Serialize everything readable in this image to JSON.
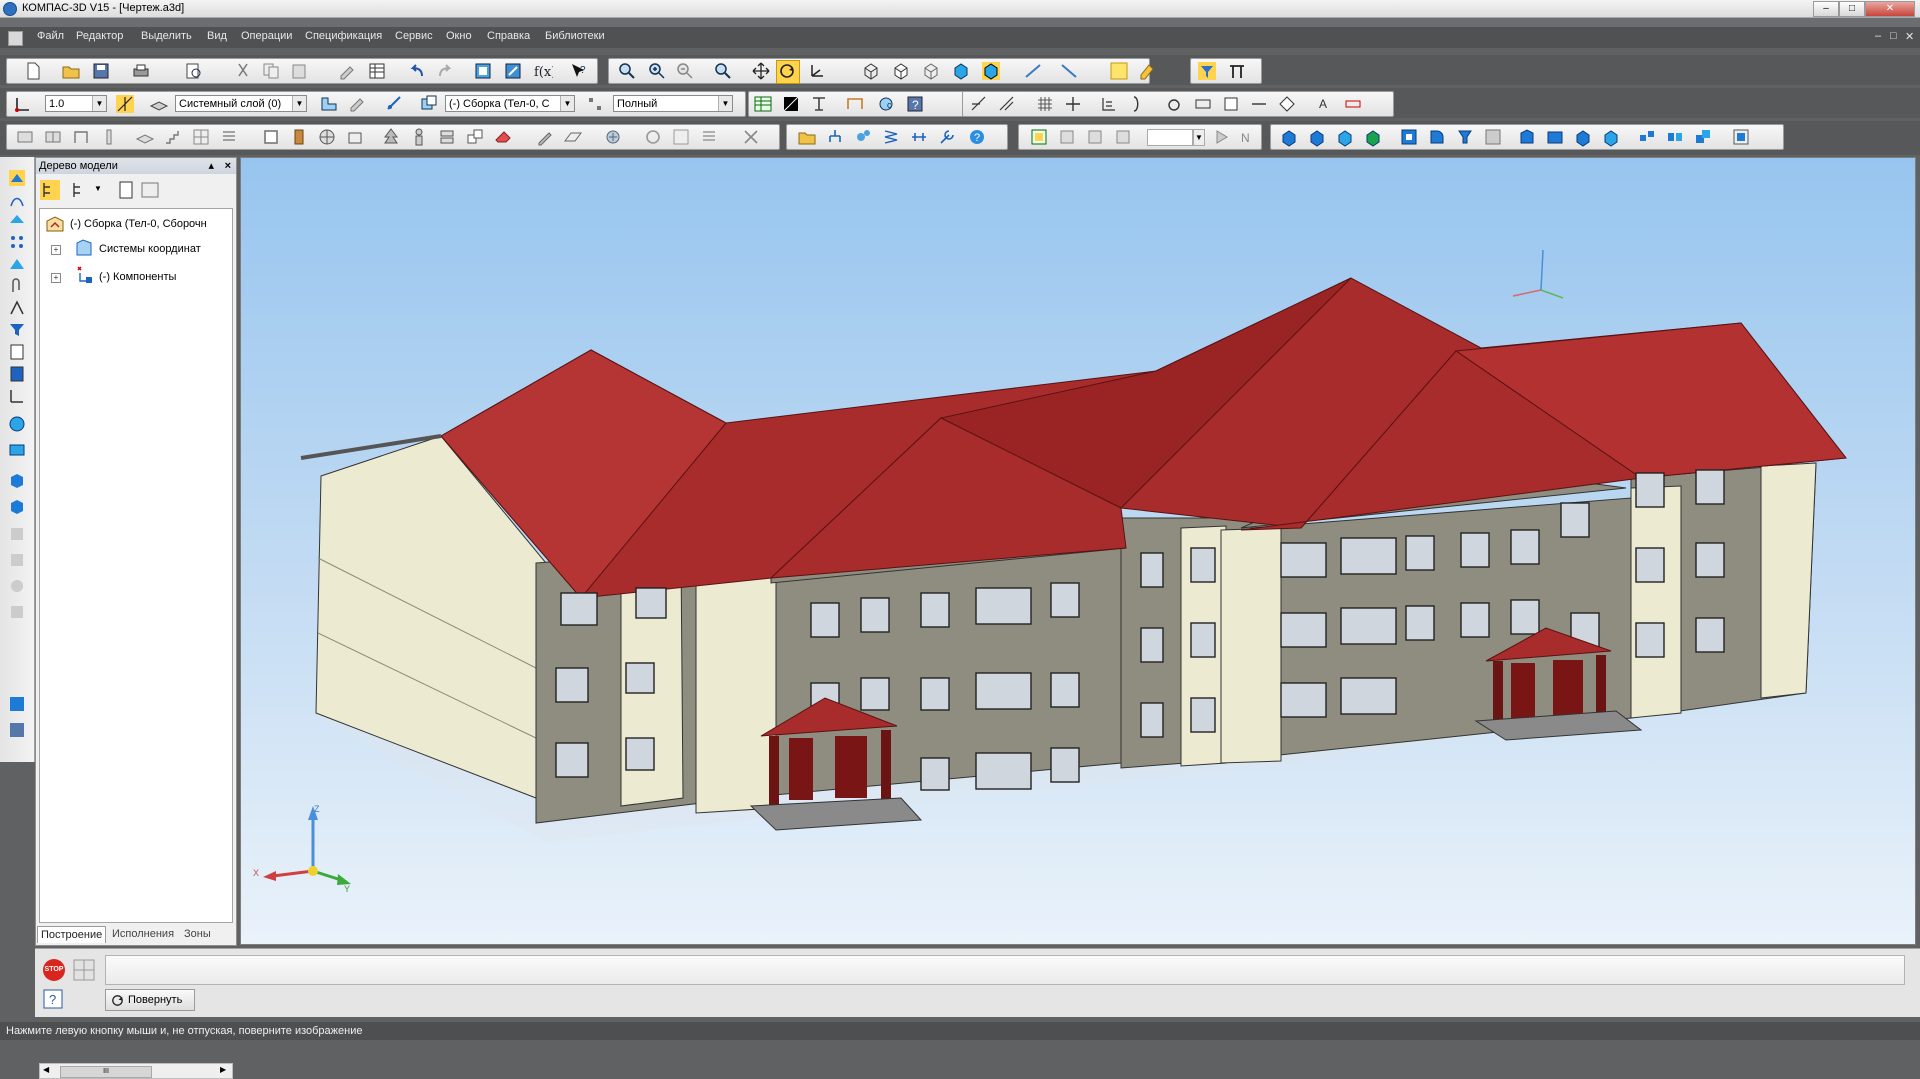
{
  "window": {
    "title": "КОМПАС-3D V15 - [Чертеж.a3d]",
    "buttons": [
      "minimize",
      "maximize",
      "close"
    ]
  },
  "menu": {
    "items": [
      "Файл",
      "Редактор",
      "Выделить",
      "Вид",
      "Операции",
      "Спецификация",
      "Сервис",
      "Окно",
      "Справка",
      "Библиотеки"
    ]
  },
  "toolbar2": {
    "step_value": "1.0",
    "layer_value": "Системный слой (0)",
    "assembly_value": "(-) Сборка (Тел-0, С",
    "render_mode_value": "Полный"
  },
  "tree": {
    "title": "Дерево модели",
    "root": "(-) Сборка (Тел-0, Сборочн",
    "items": [
      "Системы координат",
      "(-) Компоненты"
    ],
    "scroll_grip": "III",
    "tabs": [
      "Построение",
      "Исполнения",
      "Зоны"
    ]
  },
  "axes": {
    "z": "Z",
    "x": "X",
    "y": "Y"
  },
  "bottom": {
    "stop_label": "STOP",
    "rotate_button": "Повернуть"
  },
  "status": {
    "text": "Нажмите левую кнопку мыши и, не отпуская, поверните изображение"
  },
  "colors": {
    "roof": "#a82c2c",
    "wall_gray": "#8e8d7f",
    "wall_cream": "#ecead0",
    "sky_top": "#97c5ef",
    "sky_bottom": "#eaf2fa"
  }
}
